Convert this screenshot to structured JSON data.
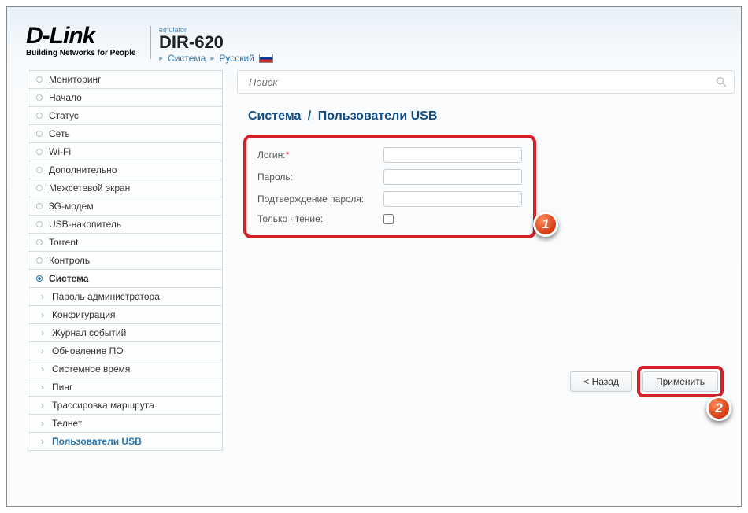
{
  "header": {
    "brand": "D-Link",
    "brand_sub": "Building Networks for People",
    "emulator_label": "emulator",
    "model": "DIR-620",
    "crumbs": {
      "system": "Система",
      "lang": "Русский"
    }
  },
  "search": {
    "placeholder": "Поиск"
  },
  "sidebar": {
    "items": [
      "Мониторинг",
      "Начало",
      "Статус",
      "Сеть",
      "Wi-Fi",
      "Дополнительно",
      "Межсетевой экран",
      "3G-модем",
      "USB-накопитель",
      "Torrent",
      "Контроль",
      "Система"
    ],
    "active_index": 11,
    "subs": [
      "Пароль администратора",
      "Конфигурация",
      "Журнал событий",
      "Обновление ПО",
      "Системное время",
      "Пинг",
      "Трассировка маршрута",
      "Телнет",
      "Пользователи USB"
    ],
    "current_sub_index": 8
  },
  "page": {
    "crumb1": "Система",
    "sep": "/",
    "title": "Пользователи USB"
  },
  "form": {
    "login_label": "Логин:",
    "login_value": "",
    "password_label": "Пароль:",
    "password_value": "",
    "confirm_label": "Подтверждение пароля:",
    "confirm_value": "",
    "readonly_label": "Только чтение:",
    "readonly_checked": false
  },
  "buttons": {
    "back": "< Назад",
    "apply": "Применить"
  },
  "markers": {
    "one": "1",
    "two": "2"
  }
}
